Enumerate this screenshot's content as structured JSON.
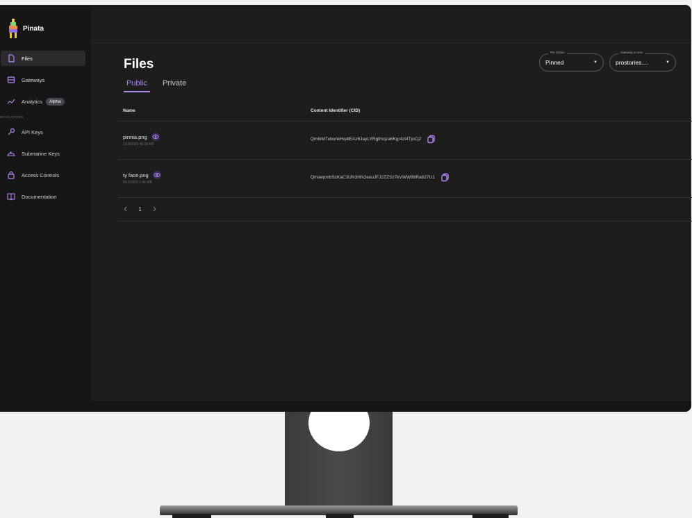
{
  "brand": {
    "name": "Pinata"
  },
  "sidebar": {
    "items": [
      {
        "label": "Files",
        "icon": "file-icon",
        "active": true
      },
      {
        "label": "Gateways",
        "icon": "gateway-icon"
      },
      {
        "label": "Analytics",
        "icon": "chart-line-icon",
        "badge": "Alpha"
      }
    ],
    "developers_items": [
      {
        "label": "API Keys",
        "icon": "key-icon"
      },
      {
        "label": "Submarine Keys",
        "icon": "submarine-icon"
      },
      {
        "label": "Access Controls",
        "icon": "lock-icon"
      },
      {
        "label": "Documentation",
        "icon": "book-icon"
      }
    ]
  },
  "page": {
    "title": "Files",
    "tabs": [
      {
        "label": "Public",
        "active": true
      },
      {
        "label": "Private"
      }
    ]
  },
  "filters": {
    "pin_status": {
      "value": "Pinned"
    },
    "gateway": {
      "value": "prostories...."
    }
  },
  "table": {
    "headers": {
      "name": "Name",
      "cid": "Content Identifier (CID)"
    },
    "rows": [
      {
        "name": "pinnia.png",
        "cid": "QmbiMTubonkHq4lEAz6JayLYRgfmqza6Kgr4zi4TjoCj2"
      },
      {
        "name": "ty face.png",
        "cid": "QmaepmbScKaC3UN3HN2euuJFJ2ZZSz7kVWW88Ra827U1"
      }
    ]
  },
  "pagination": {
    "page": "1"
  },
  "colors": {
    "accent": "#a88ae8",
    "background": "#1d1d1e",
    "sidebar": "#161617"
  }
}
